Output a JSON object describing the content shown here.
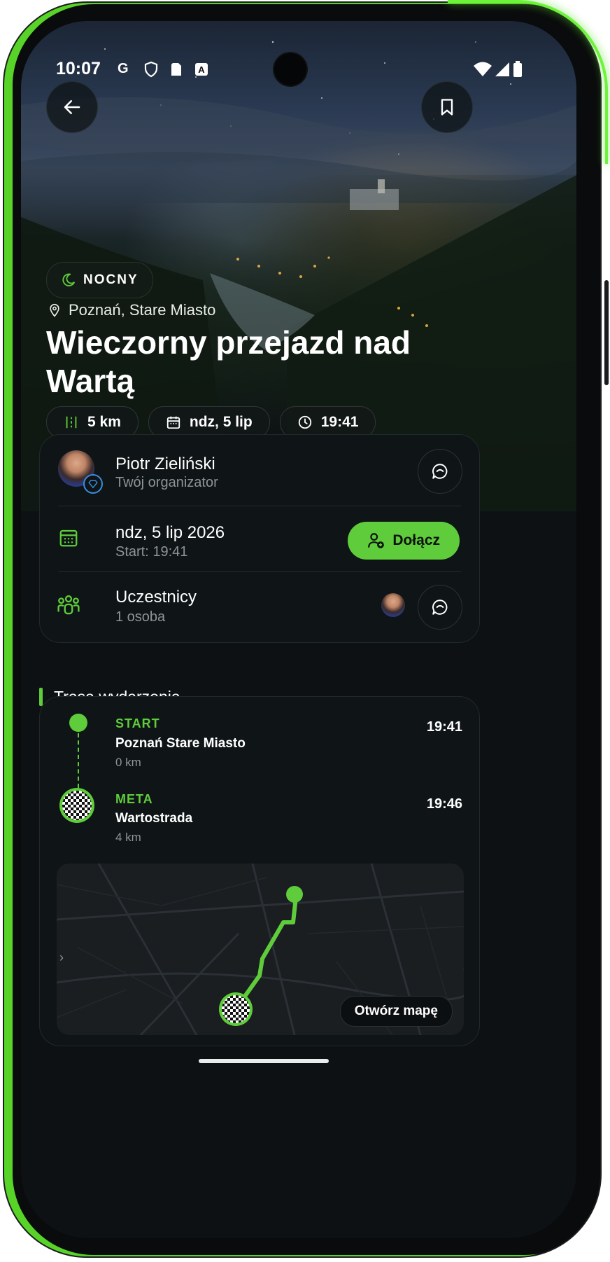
{
  "status_bar": {
    "time": "10:07",
    "left_icons": [
      "google-icon",
      "shield-icon",
      "sim-icon",
      "text-a-icon"
    ],
    "right_icons": [
      "wifi-icon",
      "signal-icon",
      "battery-icon"
    ]
  },
  "header": {
    "back_icon": "arrow-left-icon",
    "bookmark_icon": "bookmark-icon"
  },
  "hero": {
    "badge": "NOCNY",
    "location": "Poznań, Stare Miasto",
    "title": "Wieczorny przejazd nad Wartą",
    "chips": [
      {
        "icon": "distance-icon",
        "label": "5 km"
      },
      {
        "icon": "calendar-icon",
        "label": "ndz, 5 lip"
      },
      {
        "icon": "clock-icon",
        "label": "19:41"
      }
    ]
  },
  "info_card": {
    "organizer_name": "Piotr Zieliński",
    "organizer_role": "Twój organizator",
    "date": "ndz, 5 lip 2026",
    "start": "Start: 19:41",
    "join_label": "Dołącz",
    "participants_title": "Uczestnicy",
    "participants_count": "1 osoba"
  },
  "route_section": {
    "title": "Trasa wydarzenia",
    "points": [
      {
        "label": "START",
        "name": "Poznań Stare Miasto",
        "km": "0 km",
        "time": "19:41"
      },
      {
        "label": "META",
        "name": "Wartostrada",
        "km": "4 km",
        "time": "19:46"
      }
    ],
    "open_map": "Otwórz mapę"
  },
  "colors": {
    "accent": "#5fcd3b",
    "background": "#0d1114",
    "card": "#0f1416"
  }
}
